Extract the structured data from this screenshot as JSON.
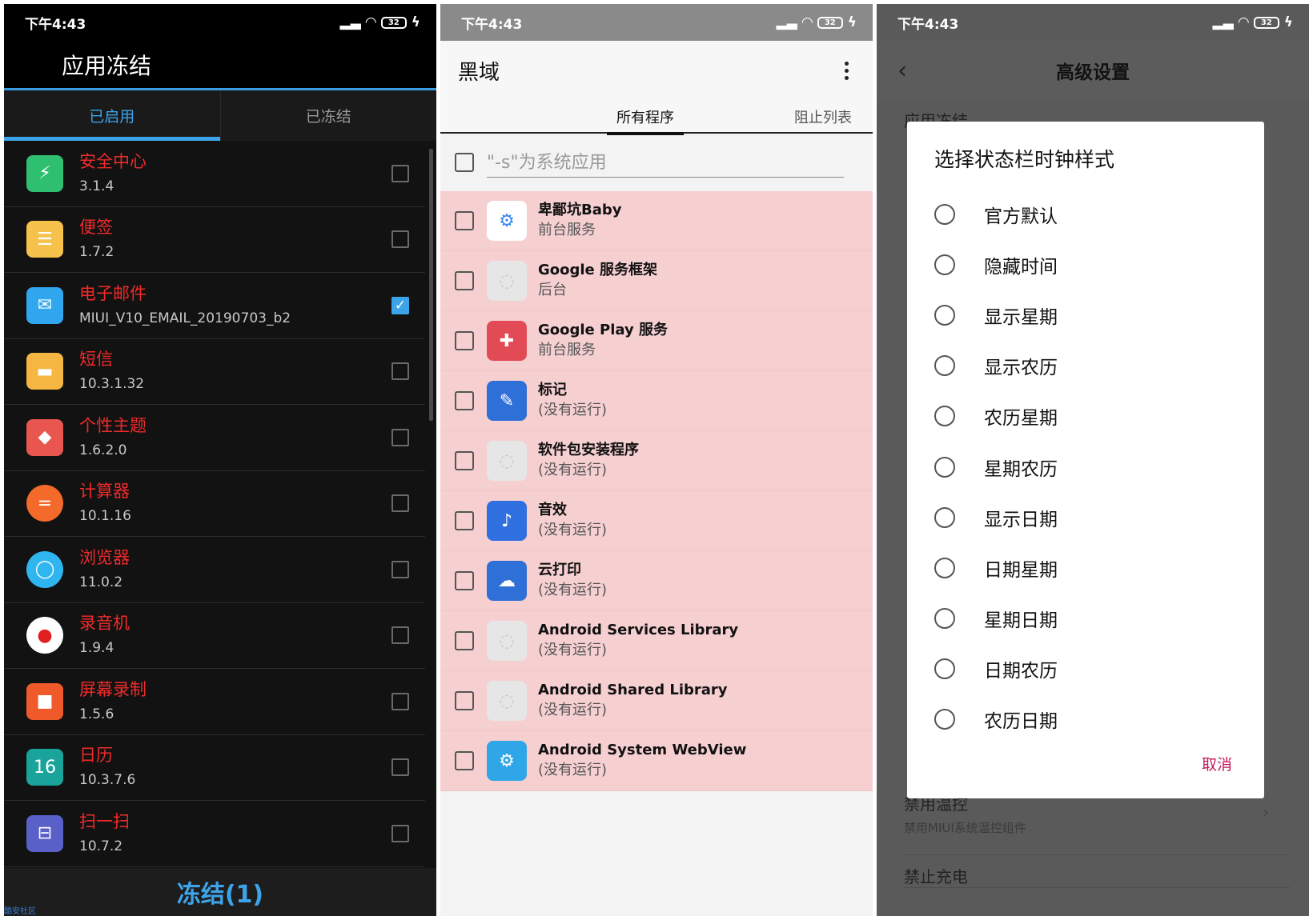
{
  "status": {
    "time": "下午4:43",
    "battery": "32"
  },
  "panel1": {
    "title": "应用冻结",
    "tabs": [
      "已启用",
      "已冻结"
    ],
    "apps": [
      {
        "name": "安全中心",
        "version": "3.1.4",
        "icon": "shield-icon",
        "color": "#2fbf71",
        "checked": false,
        "glyph": "⚡"
      },
      {
        "name": "便签",
        "version": "1.7.2",
        "icon": "notes-icon",
        "color": "#f7c24b",
        "checked": false,
        "glyph": "☰"
      },
      {
        "name": "电子邮件",
        "version": "MIUI_V10_EMAIL_20190703_b2",
        "icon": "email-icon",
        "color": "#2fa6ee",
        "checked": true,
        "glyph": "✉"
      },
      {
        "name": "短信",
        "version": "10.3.1.32",
        "icon": "message-icon",
        "color": "#f5b642",
        "checked": false,
        "glyph": "▬"
      },
      {
        "name": "个性主题",
        "version": "1.6.2.0",
        "icon": "theme-icon",
        "color": "#e9564f",
        "checked": false,
        "glyph": "◆"
      },
      {
        "name": "计算器",
        "version": "10.1.16",
        "icon": "calculator-icon",
        "color": "#f46a2b",
        "checked": false,
        "glyph": "="
      },
      {
        "name": "浏览器",
        "version": "11.0.2",
        "icon": "browser-icon",
        "color": "#2fb5ef",
        "checked": false,
        "glyph": "◯"
      },
      {
        "name": "录音机",
        "version": "1.9.4",
        "icon": "recorder-icon",
        "color": "#ffffff",
        "checked": false,
        "glyph": "●"
      },
      {
        "name": "屏幕录制",
        "version": "1.5.6",
        "icon": "screen-record-icon",
        "color": "#f05a2a",
        "checked": false,
        "glyph": "■"
      },
      {
        "name": "日历",
        "version": "10.3.7.6",
        "icon": "calendar-icon",
        "color": "#1aa39a",
        "checked": false,
        "glyph": "16"
      },
      {
        "name": "扫一扫",
        "version": "10.7.2",
        "icon": "scan-icon",
        "color": "#5960c8",
        "checked": false,
        "glyph": "⊟"
      }
    ],
    "footer": "冻结(1)",
    "watermark": "酷安社区"
  },
  "panel2": {
    "title": "黑域",
    "tabs": [
      "所有程序",
      "阻止列表"
    ],
    "filter_placeholder": "\"-s\"为系统应用",
    "apps": [
      {
        "name": "卑鄙坑Baby",
        "status": "前台服务",
        "icon": "gear-icon",
        "color": "#3a86e8",
        "glyph": "⚙",
        "bg": "#ffffff"
      },
      {
        "name": "Google 服务框架",
        "status": "后台",
        "icon": "default-app-icon",
        "color": "#e0e0e0",
        "glyph": "◌",
        "bg": "#e6e6e6"
      },
      {
        "name": "Google Play 服务",
        "status": "前台服务",
        "icon": "puzzle-icon",
        "color": "#d83a4a",
        "glyph": "✚",
        "bg": "#e24a56"
      },
      {
        "name": "标记",
        "status": "(没有运行)",
        "icon": "markup-icon",
        "color": "#2f6fd8",
        "glyph": "✎",
        "bg": "#2f6fd8"
      },
      {
        "name": "软件包安装程序",
        "status": "(没有运行)",
        "icon": "default-app-icon",
        "color": "#e0e0e0",
        "glyph": "◌",
        "bg": "#e6e6e6"
      },
      {
        "name": "音效",
        "status": "(没有运行)",
        "icon": "sound-effect-icon",
        "color": "#2f6fe0",
        "glyph": "♪",
        "bg": "#2f6fe0"
      },
      {
        "name": "云打印",
        "status": "(没有运行)",
        "icon": "cloud-print-icon",
        "color": "#2f6fd8",
        "glyph": "☁",
        "bg": "#2f6fd8"
      },
      {
        "name": "Android Services Library",
        "status": "(没有运行)",
        "icon": "default-app-icon",
        "color": "#e0e0e0",
        "glyph": "◌",
        "bg": "#e6e6e6"
      },
      {
        "name": "Android Shared Library",
        "status": "(没有运行)",
        "icon": "default-app-icon",
        "color": "#e0e0e0",
        "glyph": "◌",
        "bg": "#e6e6e6"
      },
      {
        "name": "Android System WebView",
        "status": "(没有运行)",
        "icon": "webview-gear-icon",
        "color": "#2fa6e8",
        "glyph": "⚙",
        "bg": "#2fa6e8"
      }
    ]
  },
  "panel3": {
    "title": "高级设置",
    "peek_item": "应用冻结",
    "dialog": {
      "title": "选择状态栏时钟样式",
      "options": [
        "官方默认",
        "隐藏时间",
        "显示星期",
        "显示农历",
        "农历星期",
        "星期农历",
        "显示日期",
        "日期星期",
        "星期日期",
        "日期农历",
        "农历日期"
      ],
      "cancel": "取消"
    },
    "bottom_item": {
      "title": "禁用温控",
      "subtitle": "禁用MIUI系统温控组件"
    },
    "bottom_item2": "禁止充电"
  }
}
